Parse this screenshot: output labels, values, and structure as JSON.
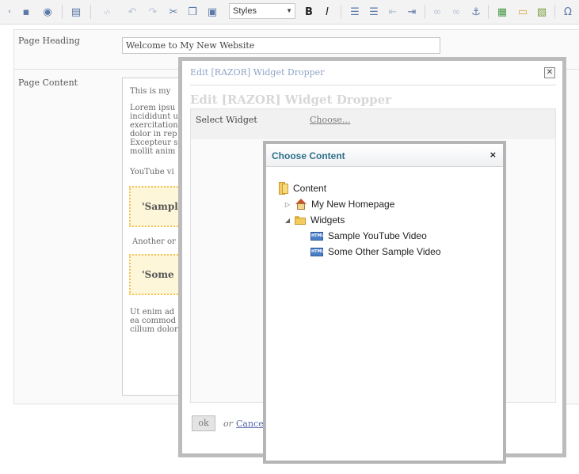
{
  "toolbar": {
    "styles_value": "Styles"
  },
  "form": {
    "page_heading_label": "Page Heading",
    "page_heading_value": "Welcome to My New Website",
    "page_content_label": "Page Content",
    "content_lines": [
      "This is my",
      "Lorem ipsu",
      "incididunt u",
      "exercitation",
      "dolor in rep",
      "Excepteur s",
      "mollit anim",
      "YouTube vi",
      "Another or",
      "Ut enim ad",
      "ea commod",
      "cillum dolor"
    ],
    "widget1_text": "'Sampl",
    "widget2_text": "'Some"
  },
  "edit_dialog": {
    "title": "Edit [RAZOR] Widget Dropper",
    "heading": "Edit [RAZOR] Widget Dropper",
    "close_symbol": "✕",
    "select_widget_label": "Select Widget",
    "choose_link": "Choose...",
    "ok_label": "ok",
    "or_text": "or",
    "cancel_label": "Cance"
  },
  "choose_dialog": {
    "title": "Choose Content",
    "close_symbol": "×",
    "tree": {
      "root": "Content",
      "home": "My New Homepage",
      "widgets": "Widgets",
      "item1": "Sample YouTube Video",
      "item2": "Some Other Sample Video"
    }
  },
  "icons": {
    "html_badge": "HTML"
  },
  "colors": {
    "dialog_title": "#2e6f8a",
    "link": "#5566aa",
    "toolbar_icon": "#5a78a8"
  }
}
